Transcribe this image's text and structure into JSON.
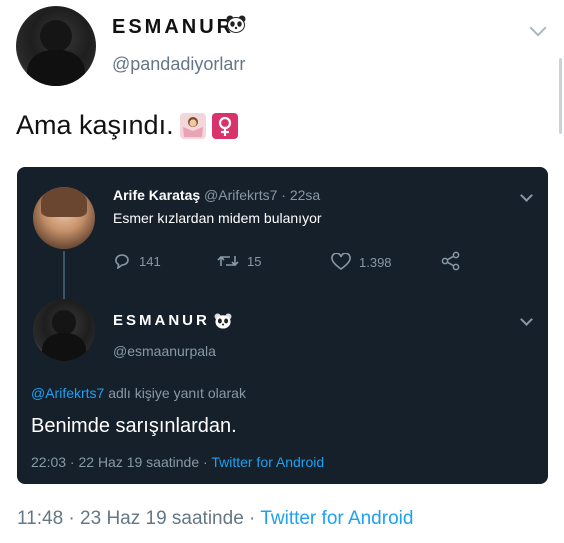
{
  "outer": {
    "name": "ESMANUR",
    "handle": "@pandadiyorlarr",
    "tweet_text": "Ama kaşındı.",
    "footer_time": "11:48",
    "footer_date": "· 23 Haz 19 saatinde ·",
    "footer_source": "Twitter for Android"
  },
  "quoted": {
    "name": "Arife Karataş",
    "handle": "@Arifekrts7",
    "time": "· 22sa",
    "text": "Esmer kızlardan midem bulanıyor",
    "replies": "141",
    "retweets": "15",
    "likes": "1.398"
  },
  "reply": {
    "name": "ESMANUR",
    "handle": "@esmaanurpala",
    "reply_to_handle": "@Arifekrts7",
    "reply_to_suffix": "adlı kişiye yanıt olarak",
    "text": "Benimde sarışınlardan.",
    "time": "22:03 · 22 Haz 19 saatinde ·",
    "source": "Twitter for Android"
  },
  "colors": {
    "dark_bg": "#15202b",
    "link_blue": "#1da1f2",
    "muted": "#8899a6"
  }
}
